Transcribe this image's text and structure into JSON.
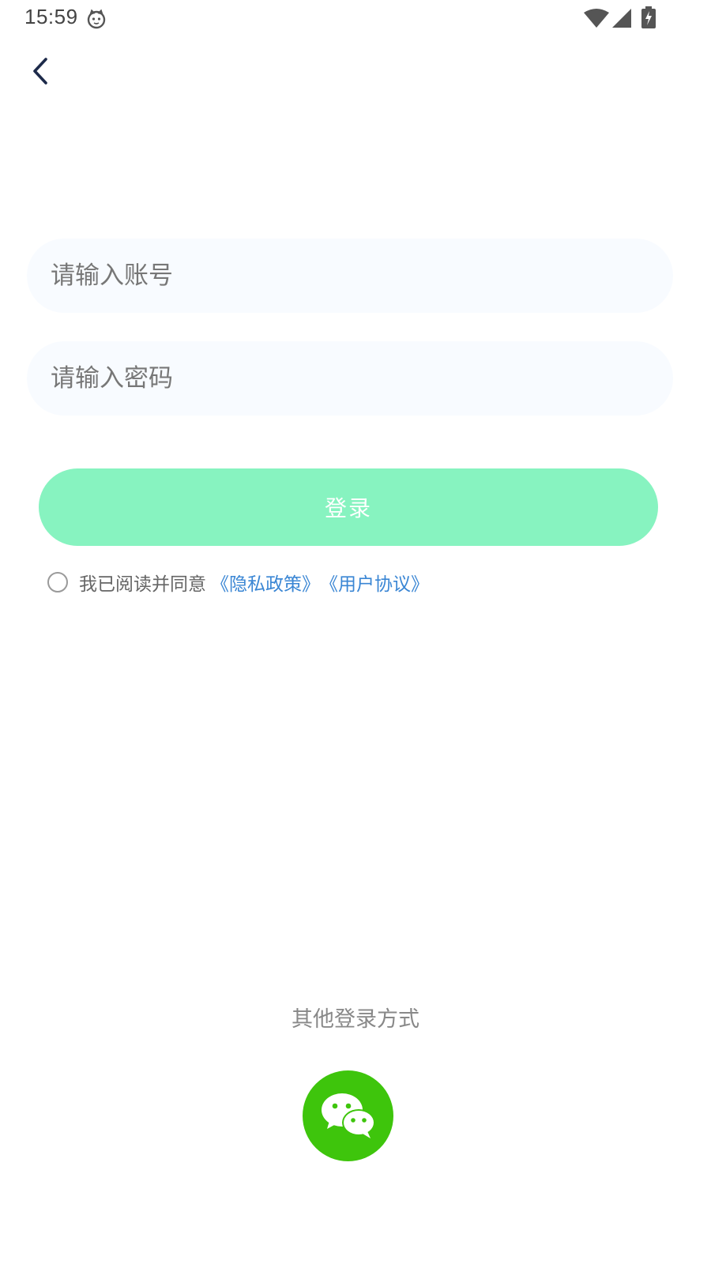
{
  "status_bar": {
    "time": "15:59",
    "app_icon": "cat-face-icon",
    "wifi_icon": "wifi-icon",
    "signal_icon": "cell-signal-icon",
    "battery_icon": "battery-charging-icon"
  },
  "nav": {
    "back_icon": "chevron-left-icon"
  },
  "form": {
    "account_placeholder": "请输入账号",
    "password_placeholder": "请输入密码",
    "login_label": "登录",
    "agree_text": "我已阅读并同意",
    "privacy_link": "《隐私政策》",
    "terms_link": "《用户协议》"
  },
  "other_login": {
    "label": "其他登录方式",
    "wechat_icon": "wechat-icon"
  },
  "colors": {
    "login_button": "#87f3c0",
    "link": "#3a86d4",
    "wechat": "#3ec50c",
    "input_bg": "#f8fbff"
  }
}
